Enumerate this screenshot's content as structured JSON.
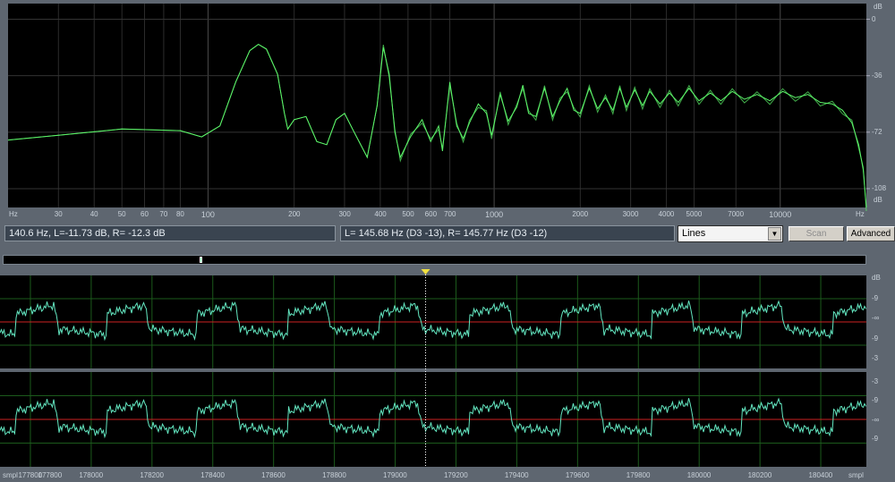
{
  "spectrum": {
    "x_unit_left": "Hz",
    "x_unit_right": "Hz",
    "y_unit_top": "dB",
    "y_unit_bottom": "dB",
    "x_ticks": [
      {
        "value": 30,
        "label": "30",
        "major": false
      },
      {
        "value": 40,
        "label": "40",
        "major": false
      },
      {
        "value": 50,
        "label": "50",
        "major": false
      },
      {
        "value": 60,
        "label": "60",
        "major": false
      },
      {
        "value": 70,
        "label": "70",
        "major": false
      },
      {
        "value": 80,
        "label": "80",
        "major": false
      },
      {
        "value": 100,
        "label": "100",
        "major": true
      },
      {
        "value": 200,
        "label": "200",
        "major": false
      },
      {
        "value": 300,
        "label": "300",
        "major": false
      },
      {
        "value": 400,
        "label": "400",
        "major": false
      },
      {
        "value": 500,
        "label": "500",
        "major": false
      },
      {
        "value": 600,
        "label": "600",
        "major": false
      },
      {
        "value": 700,
        "label": "700",
        "major": false
      },
      {
        "value": 1000,
        "label": "1000",
        "major": true
      },
      {
        "value": 2000,
        "label": "2000",
        "major": false
      },
      {
        "value": 3000,
        "label": "3000",
        "major": false
      },
      {
        "value": 4000,
        "label": "4000",
        "major": false
      },
      {
        "value": 5000,
        "label": "5000",
        "major": false
      },
      {
        "value": 7000,
        "label": "7000",
        "major": false
      },
      {
        "value": 10000,
        "label": "10000",
        "major": true
      }
    ],
    "y_ticks": [
      {
        "value": 0,
        "label": "0"
      },
      {
        "value": -36,
        "label": "-36"
      },
      {
        "value": -72,
        "label": "-72"
      },
      {
        "value": -108,
        "label": "-108"
      }
    ],
    "x_range": [
      20,
      20000
    ],
    "y_range": [
      -120,
      10
    ],
    "curve": [
      [
        20,
        -77
      ],
      [
        30,
        -74
      ],
      [
        50,
        -70
      ],
      [
        80,
        -71
      ],
      [
        95,
        -75
      ],
      [
        110,
        -68
      ],
      [
        125,
        -40
      ],
      [
        140,
        -20
      ],
      [
        150,
        -16
      ],
      [
        160,
        -19
      ],
      [
        175,
        -35
      ],
      [
        185,
        -60
      ],
      [
        190,
        -70
      ],
      [
        200,
        -64
      ],
      [
        220,
        -62
      ],
      [
        240,
        -78
      ],
      [
        260,
        -80
      ],
      [
        280,
        -64
      ],
      [
        300,
        -60
      ],
      [
        320,
        -70
      ],
      [
        360,
        -88
      ],
      [
        390,
        -55
      ],
      [
        410,
        -18
      ],
      [
        430,
        -35
      ],
      [
        450,
        -72
      ],
      [
        470,
        -88
      ],
      [
        510,
        -75
      ],
      [
        560,
        -64
      ],
      [
        600,
        -78
      ],
      [
        640,
        -68
      ],
      [
        660,
        -84
      ],
      [
        700,
        -40
      ],
      [
        740,
        -68
      ],
      [
        780,
        -76
      ],
      [
        820,
        -66
      ],
      [
        880,
        -54
      ],
      [
        940,
        -60
      ],
      [
        980,
        -74
      ],
      [
        1050,
        -48
      ],
      [
        1120,
        -65
      ],
      [
        1200,
        -56
      ],
      [
        1260,
        -42
      ],
      [
        1320,
        -60
      ],
      [
        1400,
        -62
      ],
      [
        1500,
        -44
      ],
      [
        1600,
        -62
      ],
      [
        1700,
        -52
      ],
      [
        1800,
        -44
      ],
      [
        1900,
        -58
      ],
      [
        2000,
        -60
      ],
      [
        2150,
        -44
      ],
      [
        2300,
        -57
      ],
      [
        2450,
        -50
      ],
      [
        2600,
        -58
      ],
      [
        2750,
        -44
      ],
      [
        2900,
        -56
      ],
      [
        3100,
        -45
      ],
      [
        3300,
        -55
      ],
      [
        3500,
        -46
      ],
      [
        3800,
        -54
      ],
      [
        4100,
        -47
      ],
      [
        4400,
        -53
      ],
      [
        4800,
        -44
      ],
      [
        5200,
        -52
      ],
      [
        5700,
        -47
      ],
      [
        6200,
        -52
      ],
      [
        6800,
        -46
      ],
      [
        7500,
        -51
      ],
      [
        8300,
        -48
      ],
      [
        9200,
        -52
      ],
      [
        10200,
        -46
      ],
      [
        11300,
        -50
      ],
      [
        12500,
        -48
      ],
      [
        13800,
        -53
      ],
      [
        15200,
        -54
      ],
      [
        16500,
        -58
      ],
      [
        17800,
        -66
      ],
      [
        18800,
        -80
      ],
      [
        19500,
        -96
      ],
      [
        20000,
        -120
      ]
    ],
    "colors": {
      "curve": "#5cf56a",
      "background": "#000000"
    }
  },
  "status": {
    "cursor_readout": "140.6 Hz, L=-11.73 dB, R= -12.3 dB",
    "peak_readout": "L= 145.68 Hz (D3 -13), R= 145.77 Hz (D3 -12)",
    "view_mode": "Lines",
    "scan_button": "Scan",
    "advanced_button": "Advanced"
  },
  "waveform": {
    "x_unit": "smpl",
    "x_range": [
      177700,
      180550
    ],
    "cursor_position": 179100,
    "x_ticks": [
      177800,
      178000,
      178200,
      178400,
      178600,
      178800,
      179000,
      179200,
      179400,
      179600,
      179800,
      180000,
      180200,
      180400
    ],
    "tick_labels": [
      "177800",
      "177800",
      "178000",
      "178200",
      "178400",
      "178600",
      "178800",
      "179000",
      "179200",
      "179400",
      "179600",
      "179800",
      "180000",
      "180200",
      "180400"
    ],
    "channel_top": {
      "scale_labels": [
        "dB",
        "-9",
        "-∞",
        "-9",
        "-3"
      ]
    },
    "channel_bottom": {
      "scale_labels": [
        "-3",
        "-9",
        "-∞",
        "-9"
      ]
    },
    "colors": {
      "wave": "#63e6c0",
      "zero_line": "#cc2222",
      "grid": "#1c5a1c",
      "cursor": "#ffffff"
    }
  }
}
